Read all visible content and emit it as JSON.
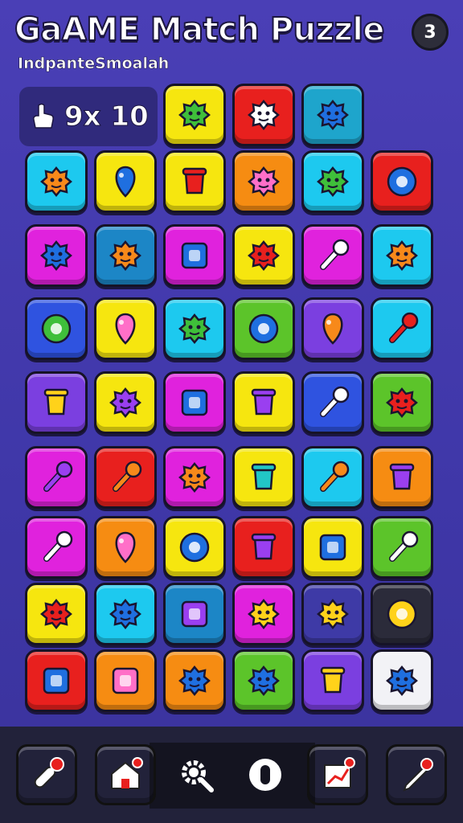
{
  "header": {
    "title": "GaAME Match Puzzle",
    "subtitle": "IndpanteSmoalah",
    "level": "3"
  },
  "moves": {
    "icon": "hand-pointer-icon",
    "text": "9x 10"
  },
  "board": {
    "rows": [
      [
        null,
        null,
        {
          "color": "#f6e60f",
          "icon": "green-monster-icon"
        },
        {
          "color": "#e8201e",
          "icon": "candy-swirl-icon"
        },
        {
          "color": "#1ea5cc",
          "icon": "blue-shield-icon"
        },
        null
      ],
      [
        {
          "color": "#1dc9ef",
          "icon": "orange-gear-icon"
        },
        {
          "color": "#f6e60f",
          "icon": "blue-balloon-icon"
        },
        {
          "color": "#f6e60f",
          "icon": "red-pot-icon"
        },
        {
          "color": "#f68c12",
          "icon": "pink-blob-icon"
        },
        {
          "color": "#1dc9ef",
          "icon": "green-monster-face-icon"
        },
        {
          "color": "#e8201e",
          "icon": "blue-sun-icon"
        }
      ],
      [
        {
          "color": "#e022dd",
          "icon": "blue-bird-icon"
        },
        {
          "color": "#1c86c6",
          "icon": "orange-face-icon"
        },
        {
          "color": "#e022dd",
          "icon": "blue-frame-icon"
        },
        {
          "color": "#f6e60f",
          "icon": "red-clock-icon"
        },
        {
          "color": "#e022dd",
          "icon": "crossed-tools-icon"
        },
        {
          "color": "#1dc9ef",
          "icon": "orange-fluffball-icon"
        }
      ],
      [
        {
          "color": "#2f53e0",
          "icon": "green-ring-icon"
        },
        {
          "color": "#f6e60f",
          "icon": "pink-drop-icon"
        },
        {
          "color": "#1dc9ef",
          "icon": "green-leaf-icon"
        },
        {
          "color": "#5cc42a",
          "icon": "blue-gem-icon"
        },
        {
          "color": "#7b3fe0",
          "icon": "orange-balloon-icon"
        },
        {
          "color": "#1dc9ef",
          "icon": "red-umbrella-icon"
        }
      ],
      [
        {
          "color": "#7b3fe0",
          "icon": "yellow-pot-icon"
        },
        {
          "color": "#f6e60f",
          "icon": "purple-blob-icon"
        },
        {
          "color": "#e022dd",
          "icon": "blue-frame-icon"
        },
        {
          "color": "#f6e60f",
          "icon": "purple-jar-icon"
        },
        {
          "color": "#2f53e0",
          "icon": "magnifier-icon"
        },
        {
          "color": "#5cc42a",
          "icon": "red-bird-icon"
        }
      ],
      [
        {
          "color": "#e022dd",
          "icon": "purple-tool-icon"
        },
        {
          "color": "#e8201e",
          "icon": "orange-lollipop-icon"
        },
        {
          "color": "#e022dd",
          "icon": "orange-candy-icon"
        },
        {
          "color": "#f6e60f",
          "icon": "teal-anvil-icon"
        },
        {
          "color": "#1dc9ef",
          "icon": "orange-rocket-icon"
        },
        {
          "color": "#f68c12",
          "icon": "purple-jar-icon"
        }
      ],
      [
        {
          "color": "#e022dd",
          "icon": "compass-icon"
        },
        {
          "color": "#f68c12",
          "icon": "pink-drop-icon"
        },
        {
          "color": "#f6e60f",
          "icon": "blue-ring-icon"
        },
        {
          "color": "#e8201e",
          "icon": "purple-bottle-icon"
        },
        {
          "color": "#f6e60f",
          "icon": "blue-radio-icon"
        },
        {
          "color": "#5cc42a",
          "icon": "white-magnifier-icon"
        }
      ],
      [
        {
          "color": "#f6e60f",
          "icon": "red-blob-icon"
        },
        {
          "color": "#1dc9ef",
          "icon": "blue-robot-icon"
        },
        {
          "color": "#1c86c6",
          "icon": "purple-square-icon"
        },
        {
          "color": "#e022dd",
          "icon": "yellow-star-icon"
        },
        {
          "color": "#3e3aa6",
          "icon": "yellow-mask-icon"
        },
        {
          "color": "#2b2b3a",
          "icon": "yellow-sun-icon"
        }
      ],
      [
        {
          "color": "#e8201e",
          "icon": "blue-arrow-icon"
        },
        {
          "color": "#f68c12",
          "icon": "pink-box-icon"
        },
        {
          "color": "#f68c12",
          "icon": "blue-phone-icon"
        },
        {
          "color": "#5cc42a",
          "icon": "blue-fluffball-icon"
        },
        {
          "color": "#7b3fe0",
          "icon": "yellow-pot-icon"
        },
        {
          "color": "#f2f2f6",
          "icon": "blue-bomb-icon"
        }
      ]
    ]
  },
  "bottom_nav": [
    {
      "name": "rocket-button",
      "icon": "rocket-icon",
      "color": "#e8201e"
    },
    {
      "name": "home-button",
      "icon": "home-icon",
      "color": "#f68c12"
    },
    {
      "name": "settings-button",
      "icon": "gear-magnifier-icon",
      "color": null
    },
    {
      "name": "toggle-button",
      "icon": "toggle-icon",
      "color": null
    },
    {
      "name": "chart-button",
      "icon": "chart-icon",
      "color": "#e8201e"
    },
    {
      "name": "edit-button",
      "icon": "pencil-icon",
      "color": "#5cc42a"
    }
  ]
}
